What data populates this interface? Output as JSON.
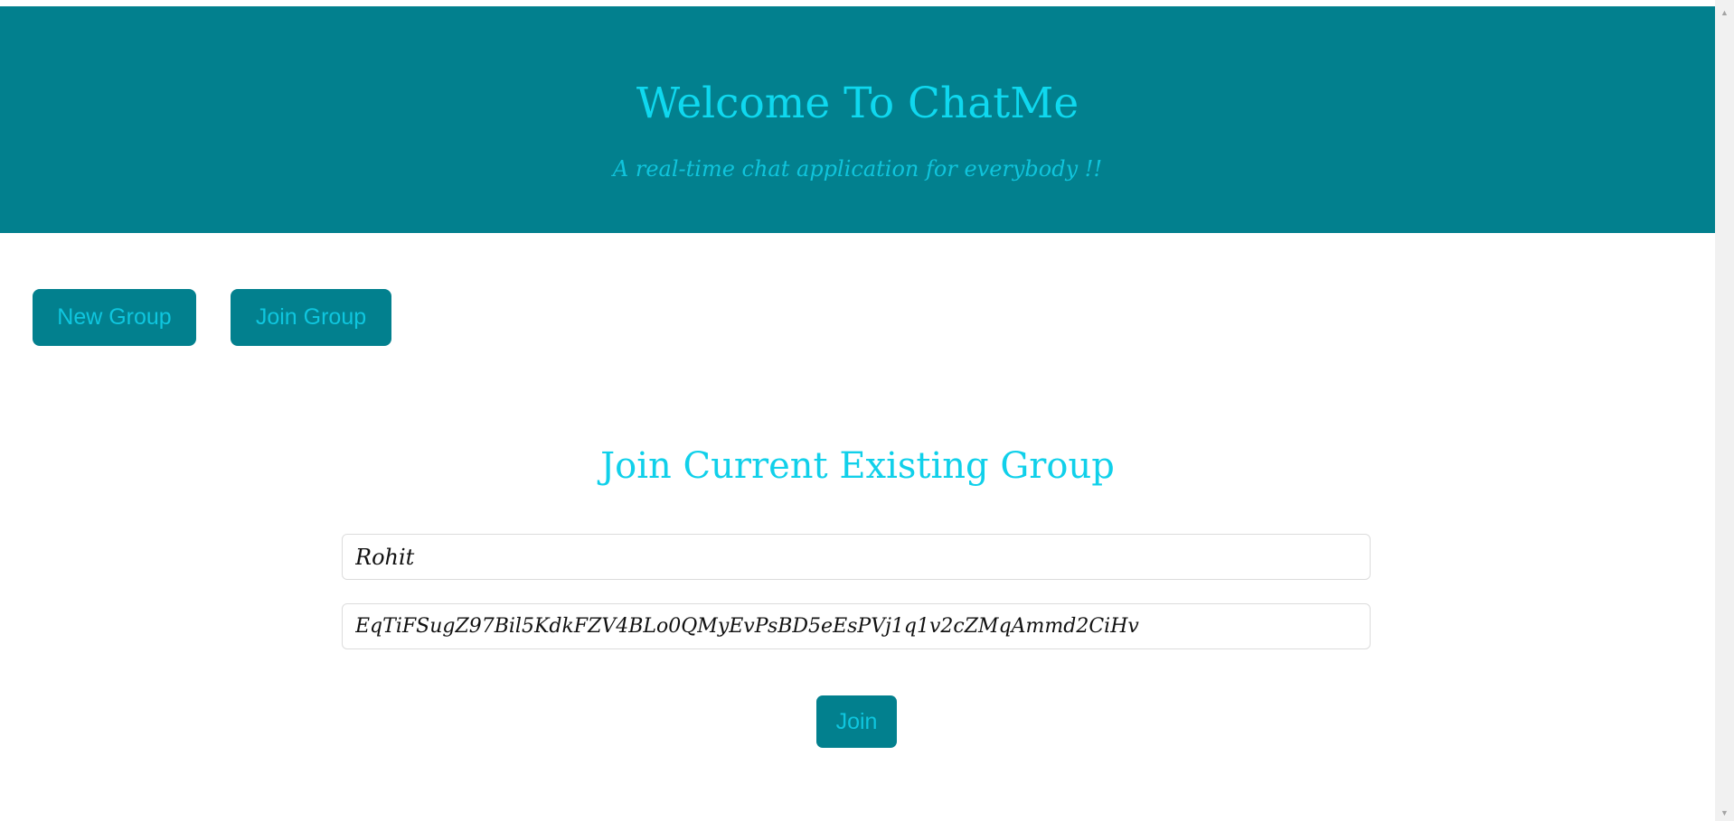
{
  "header": {
    "title": "Welcome To ChatMe",
    "subtitle": "A real-time chat application for everybody !!"
  },
  "nav": {
    "new_group_label": "New Group",
    "join_group_label": "Join Group"
  },
  "join_form": {
    "title": "Join Current Existing Group",
    "name_value": "Rohit",
    "group_code_value": "EqTiFSugZ97Bil5KdkFZV4BLo0QMyEvPsBD5eEsPVj1q1v2cZMqAmmd2CiHv",
    "join_label": "Join"
  },
  "colors": {
    "accent": "#02808e",
    "title_cyan": "#0fd8ef",
    "button_text": "#0fc6df"
  },
  "icons": {
    "scroll_up": "scroll-up-arrow-icon",
    "scroll_down": "scroll-down-arrow-icon"
  }
}
